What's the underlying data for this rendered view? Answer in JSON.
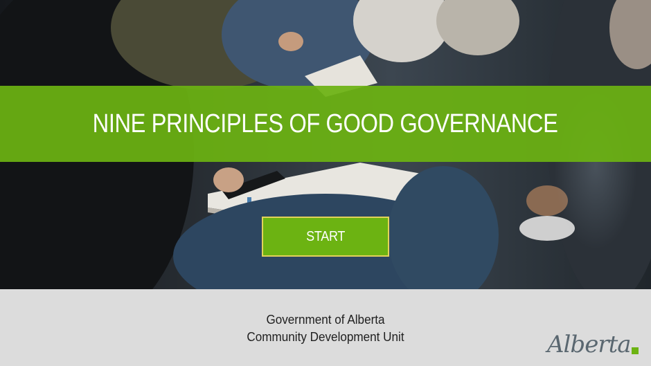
{
  "title": "NINE PRINCIPLES OF GOOD GOVERNANCE",
  "start_label": "START",
  "footer": {
    "line1": "Government of Alberta",
    "line2": "Community Development Unit"
  },
  "logo": {
    "text": "Alberta"
  },
  "colors": {
    "accent_green": "#6cb312",
    "button_border": "#e3d35a",
    "footer_bg": "#dcdcdc",
    "logo_grey": "#5a6770"
  },
  "icons": {
    "background": "photo-audience-with-notebooks"
  }
}
